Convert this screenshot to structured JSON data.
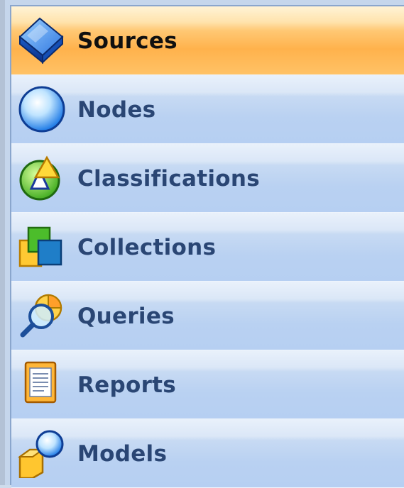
{
  "nav": {
    "items": [
      {
        "label": "Sources",
        "icon": "sources-icon",
        "selected": true
      },
      {
        "label": "Nodes",
        "icon": "nodes-icon",
        "selected": false
      },
      {
        "label": "Classifications",
        "icon": "classifications-icon",
        "selected": false
      },
      {
        "label": "Collections",
        "icon": "collections-icon",
        "selected": false
      },
      {
        "label": "Queries",
        "icon": "queries-icon",
        "selected": false
      },
      {
        "label": "Reports",
        "icon": "reports-icon",
        "selected": false
      },
      {
        "label": "Models",
        "icon": "models-icon",
        "selected": false
      }
    ]
  },
  "colors": {
    "selected_bg": "#ffb24c",
    "item_bg": "#b9d1f2",
    "label_text": "#2a4674",
    "selected_text": "#101010",
    "border": "#8aa6cd"
  }
}
